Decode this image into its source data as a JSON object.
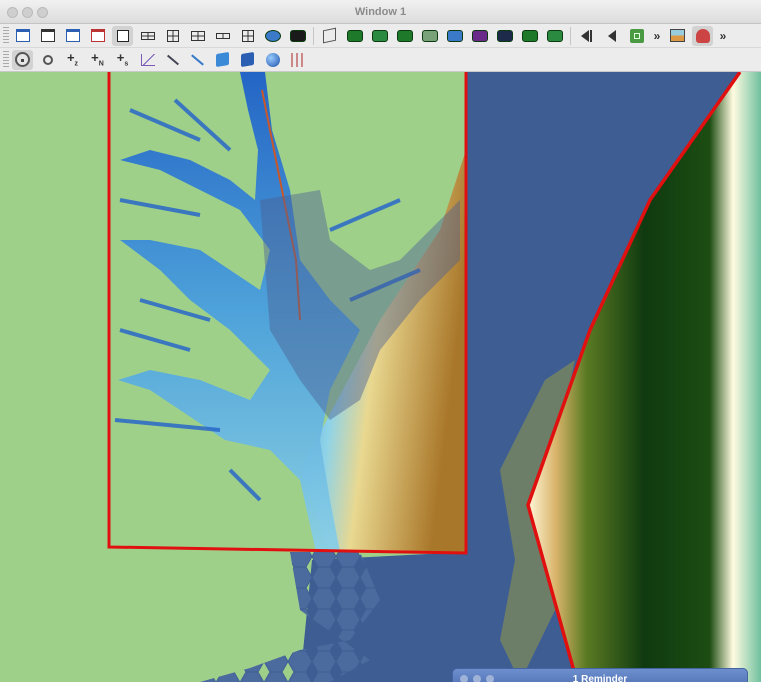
{
  "window": {
    "title": "Window 1"
  },
  "reminder": {
    "title": "1 Reminder"
  },
  "toolbar_overflow": "»",
  "colors": {
    "land": "#9fd08a",
    "water": "#3e5d93",
    "boundary": "#e01010",
    "relief_high": "#b0852c",
    "relief_low": "#1d5fc8"
  },
  "toolbar1_icons": [
    "view-window-icon",
    "new-window-icon",
    "tile-windows-icon",
    "close-window-icon",
    "single-pane-icon",
    "split-horizontal-icon",
    "split-quad-icon",
    "grid-3x3-icon",
    "grid-strip-icon",
    "grid-4x4-icon",
    "export-3d-icon",
    "toggle-overlay-icon",
    "perspective-cube-icon",
    "camera-front-icon",
    "camera-back-icon",
    "camera-left-icon",
    "camera-right-icon",
    "camera-top-icon",
    "camera-purple-icon",
    "camera-dark-icon",
    "camera-green-icon",
    "camera-save-icon",
    "step-back-icon",
    "play-back-icon",
    "stop-icon",
    "picture-icon",
    "user-icon"
  ],
  "toolbar2_icons": [
    "pan-icon",
    "zoom-icon",
    "add-z-point-icon",
    "add-n-point-icon",
    "add-s-point-icon",
    "profile-graph-icon",
    "pick-tool-icon",
    "draw-line-icon",
    "extrude-icon",
    "box-icon",
    "sphere-icon",
    "equalizer-icon"
  ]
}
